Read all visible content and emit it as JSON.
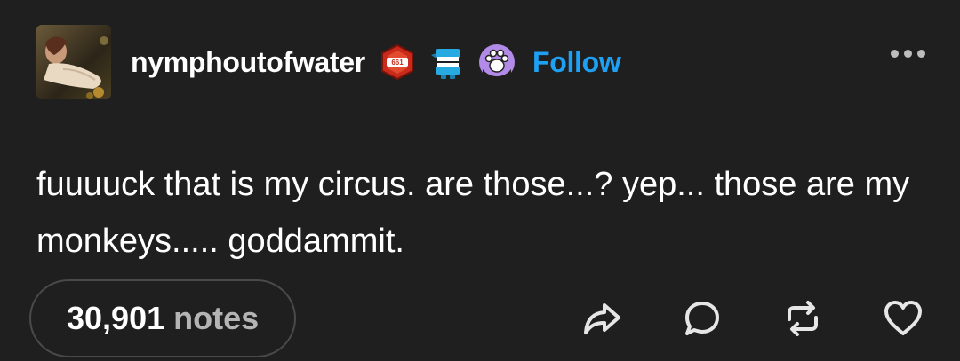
{
  "post": {
    "username": "nymphoutofwater",
    "follow_label": "Follow",
    "text": "fuuuuck that is my circus. are those...? yep... those are my monkeys..... goddammit.",
    "badges": [
      "red-hexagon-badge",
      "chattering-teeth-badge",
      "paw-print-badge"
    ],
    "badge_red_text": "661"
  },
  "footer": {
    "notes_count": "30,901",
    "notes_label": "notes",
    "actions": [
      "share-icon",
      "reply-icon",
      "reblog-icon",
      "like-icon"
    ]
  },
  "colors": {
    "background": "#1f1f1f",
    "follow": "#1ea0f5",
    "text": "#ffffff",
    "muted": "#b4b4b4"
  }
}
